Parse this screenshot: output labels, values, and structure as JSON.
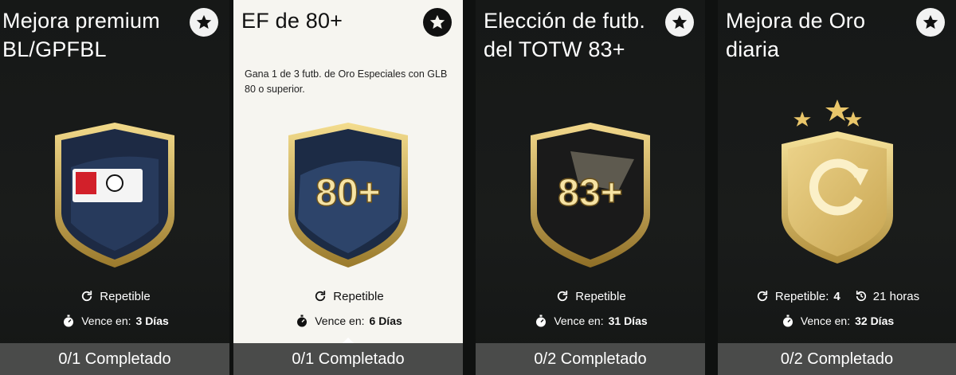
{
  "cards": [
    {
      "title": "Mejora premium BL/GPFBL",
      "badge_text": "",
      "badge_icon": "bundesliga-shield-icon",
      "repeat_label": "Repetible",
      "expires_label": "Vence en:",
      "expires_value": "3 Días",
      "progress_label": "0/1 Completado"
    },
    {
      "title": "EF de 80+",
      "description": "Gana 1 de 3 futb. de Oro Especiales con GLB 80 o superior.",
      "badge_text": "80+",
      "repeat_label": "Repetible",
      "expires_label": "Vence en:",
      "expires_value": "6 Días",
      "progress_label": "0/1 Completado"
    },
    {
      "title": "Elección de futb. del TOTW 83+",
      "badge_text": "83+",
      "repeat_label": "Repetible",
      "expires_label": "Vence en:",
      "expires_value": "31 Días",
      "progress_label": "0/2 Completado"
    },
    {
      "title": "Mejora de Oro diaria",
      "badge_icon": "refresh-gold-shield-icon",
      "repeat_label": "Repetible:",
      "repeat_count": "4",
      "reset_value": "21 horas",
      "expires_label": "Vence en:",
      "expires_value": "32 Días",
      "progress_label": "0/2 Completado"
    }
  ],
  "colors": {
    "card_bg": "#161817",
    "selected_bg": "#f6f5f0",
    "progress_bg": "#4a4b4a",
    "gold": "#d9b45a"
  },
  "icons": [
    "star-icon",
    "repeat-icon",
    "stopwatch-icon",
    "history-icon"
  ]
}
